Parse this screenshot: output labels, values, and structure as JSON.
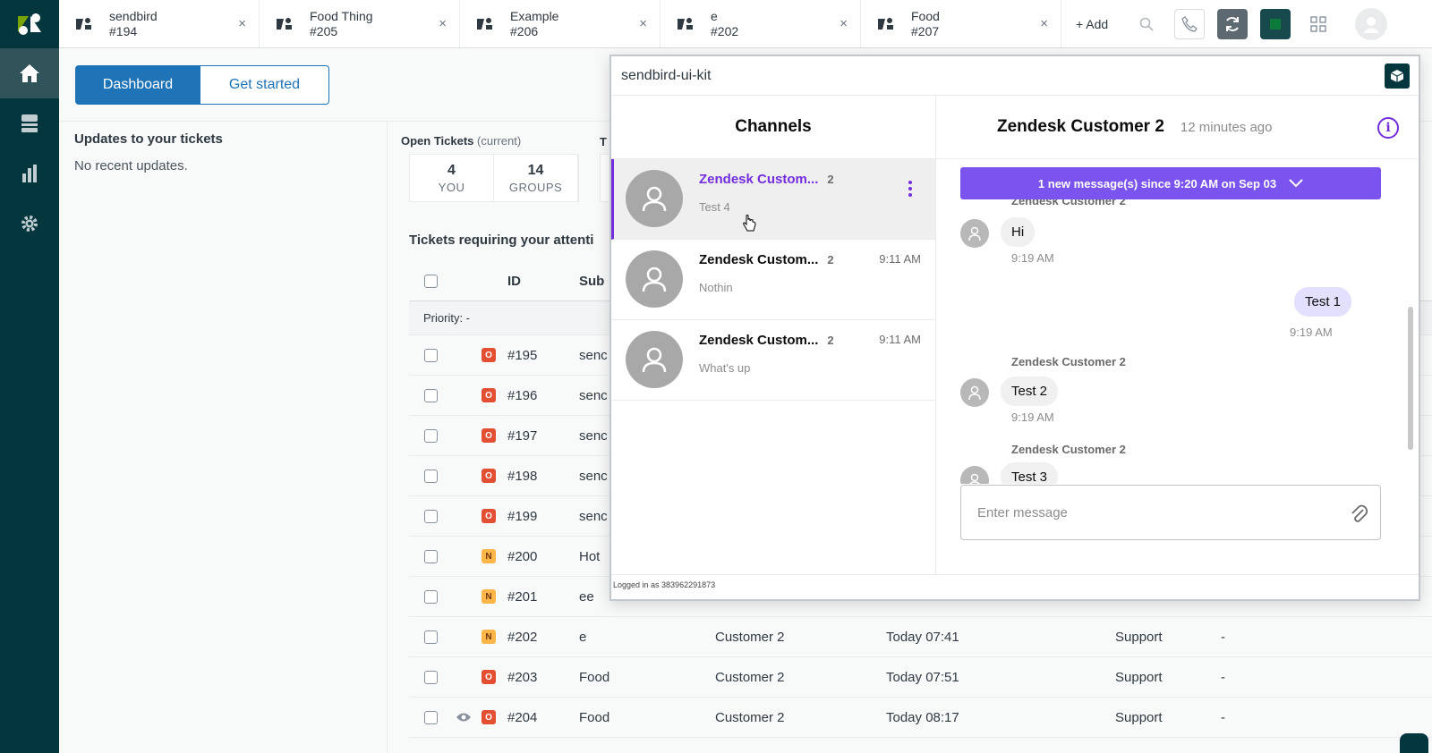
{
  "tabs": [
    {
      "title": "sendbird",
      "ticket": "#194"
    },
    {
      "title": "Food Thing",
      "ticket": "#205"
    },
    {
      "title": "Example",
      "ticket": "#206"
    },
    {
      "title": "e",
      "ticket": "#202"
    },
    {
      "title": "Food",
      "ticket": "#207"
    }
  ],
  "topbar": {
    "add_label": "+ Add",
    "close_glyph": "×"
  },
  "dashboard": {
    "btn_dashboard": "Dashboard",
    "btn_get_started": "Get started",
    "updates_title": "Updates to your tickets",
    "updates_empty": "No recent updates.",
    "open_tickets_title": "Open Tickets",
    "open_tickets_sub": "(current)",
    "second_stat_title": "T",
    "stats": [
      {
        "num": "4",
        "label": "YOU"
      },
      {
        "num": "14",
        "label": "GROUPS"
      }
    ],
    "requiring_title": "Tickets requiring your attenti",
    "col_id": "ID",
    "col_subject": "Sub",
    "priority_label": "Priority: -"
  },
  "tickets": [
    {
      "status": "O",
      "id": "#195",
      "subject": "senc",
      "requester": "",
      "updated": "",
      "group": "",
      "assignee": ""
    },
    {
      "status": "O",
      "id": "#196",
      "subject": "senc",
      "requester": "",
      "updated": "",
      "group": "",
      "assignee": ""
    },
    {
      "status": "O",
      "id": "#197",
      "subject": "senc",
      "requester": "",
      "updated": "",
      "group": "",
      "assignee": ""
    },
    {
      "status": "O",
      "id": "#198",
      "subject": "senc",
      "requester": "",
      "updated": "",
      "group": "",
      "assignee": ""
    },
    {
      "status": "O",
      "id": "#199",
      "subject": "senc",
      "requester": "",
      "updated": "",
      "group": "",
      "assignee": ""
    },
    {
      "status": "N",
      "id": "#200",
      "subject": "Hot",
      "requester": "",
      "updated": "",
      "group": "",
      "assignee": ""
    },
    {
      "status": "N",
      "id": "#201",
      "subject": "ee",
      "requester": "",
      "updated": "",
      "group": "",
      "assignee": ""
    },
    {
      "status": "N",
      "id": "#202",
      "subject": "e",
      "requester": "Customer 2",
      "updated": "Today 07:41",
      "group": "Support",
      "assignee": "-"
    },
    {
      "status": "O",
      "id": "#203",
      "subject": "Food",
      "requester": "Customer 2",
      "updated": "Today 07:51",
      "group": "Support",
      "assignee": "-"
    },
    {
      "status": "O",
      "id": "#204",
      "subject": "Food",
      "requester": "Customer 2",
      "updated": "Today 08:17",
      "group": "Support",
      "assignee": "-",
      "viewing": true
    }
  ],
  "panel": {
    "title": "sendbird-ui-kit",
    "channels_title": "Channels",
    "channels": [
      {
        "name": "Zendesk Custom...",
        "count": "2",
        "last": "Test 4",
        "time": "",
        "active": true
      },
      {
        "name": "Zendesk Custom...",
        "count": "2",
        "last": "Nothin",
        "time": "9:11 AM"
      },
      {
        "name": "Zendesk Custom...",
        "count": "2",
        "last": "What's up",
        "time": "9:11 AM"
      }
    ],
    "conversation": {
      "title": "Zendesk Customer 2",
      "last_seen": "12 minutes ago",
      "new_messages": "1 new message(s) since 9:20 AM on Sep 03",
      "sender": "Zendesk Customer 2",
      "messages": [
        {
          "text": "Hi",
          "time": "9:19 AM"
        },
        {
          "text": "Test 1",
          "time": "9:19 AM"
        },
        {
          "text": "Test 2",
          "time": "9:19 AM"
        },
        {
          "text": "Test 3"
        }
      ],
      "composer_placeholder": "Enter message"
    },
    "footer": "Logged in as 383962291873"
  },
  "colors": {
    "nav_bg": "#03363d",
    "primary_blue": "#1f73b7",
    "sendbird_purple": "#742ddd",
    "new_msg_bar": "#7b53ef",
    "badge_open": "#e34f32",
    "badge_new": "#ffb648"
  }
}
